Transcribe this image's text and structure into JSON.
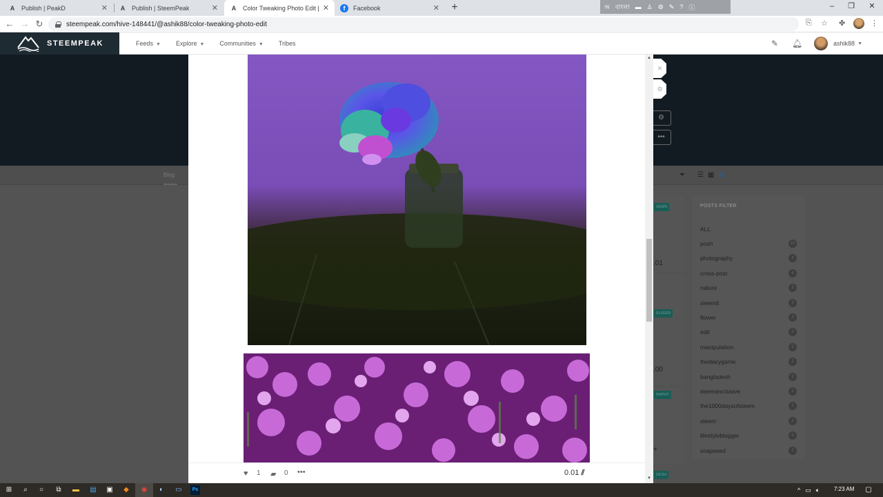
{
  "browser": {
    "tabs": [
      {
        "title": "Publish | PeakD",
        "favicon": "A",
        "active": false
      },
      {
        "title": "Publish | SteemPeak",
        "favicon": "A",
        "active": false
      },
      {
        "title": "Color Tweaking Photo Edit | Stee",
        "favicon": "A",
        "active": true
      },
      {
        "title": "Facebook",
        "favicon": "f",
        "active": false
      }
    ],
    "new_tab": "+",
    "url": "steempeak.com/hive-148441/@ashik88/color-tweaking-photo-edit",
    "ext_label": "বাংলা"
  },
  "site": {
    "logo_text": "STEEMPEAK",
    "nav": [
      {
        "label": "Feeds",
        "has_caret": true
      },
      {
        "label": "Explore",
        "has_caret": true
      },
      {
        "label": "Communities",
        "has_caret": true
      },
      {
        "label": "Tribes",
        "has_caret": false
      }
    ],
    "username": "ashik88"
  },
  "background_page": {
    "blog_tab": "Blog",
    "posts_filter_title": "POSTS FILTER",
    "filters": [
      {
        "name": "ALL",
        "count": ""
      },
      {
        "name": "posh",
        "count": "15"
      },
      {
        "name": "photography",
        "count": "4"
      },
      {
        "name": "cross-post",
        "count": "4"
      },
      {
        "name": "nature",
        "count": "3"
      },
      {
        "name": "steemit",
        "count": "3"
      },
      {
        "name": "flower",
        "count": "3"
      },
      {
        "name": "edit",
        "count": "2"
      },
      {
        "name": "manipulation",
        "count": "2"
      },
      {
        "name": "thediarygame",
        "count": "2"
      },
      {
        "name": "bangladesh",
        "count": "2"
      },
      {
        "name": "steemexclusive",
        "count": "2"
      },
      {
        "name": "the1000daysofsteem",
        "count": "2"
      },
      {
        "name": "steem",
        "count": "2"
      },
      {
        "name": "lifestyleblogger",
        "count": "2"
      },
      {
        "name": "snapseed",
        "count": "2"
      }
    ],
    "card_tags": [
      "GEMS",
      "ELFEED",
      "RAPHY",
      "DESH"
    ],
    "card_values": [
      ".01",
      ".00",
      "+"
    ]
  },
  "modal": {
    "likes": "1",
    "comments": "0",
    "payout": "0.01"
  },
  "taskbar": {
    "time": "7:23 AM"
  },
  "colors": {
    "logo_bg": "#1f2b33",
    "accent_tag": "#1a5d57",
    "photo_purple": "#8a5cc4"
  }
}
